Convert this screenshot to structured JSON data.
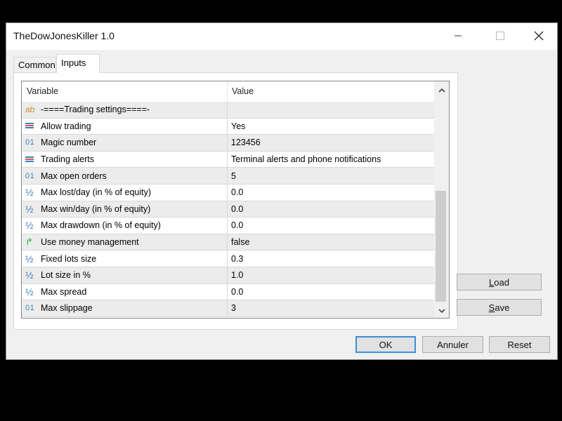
{
  "window": {
    "title": "TheDowJonesKiller 1.0",
    "controls": {
      "minimize": "minimize",
      "maximize": "maximize",
      "close": "close"
    }
  },
  "tabs": [
    {
      "label": "Common",
      "active": false
    },
    {
      "label": "Inputs",
      "active": true
    }
  ],
  "grid": {
    "columns": [
      "Variable",
      "Value"
    ],
    "rows": [
      {
        "icon": "string-icon",
        "variable": "-====Trading settings====-",
        "value": ""
      },
      {
        "icon": "enum-icon",
        "variable": "Allow trading",
        "value": "Yes"
      },
      {
        "icon": "integer-icon",
        "variable": "Magic number",
        "value": "123456"
      },
      {
        "icon": "enum-icon",
        "variable": "Trading alerts",
        "value": "Terminal alerts and phone notifications"
      },
      {
        "icon": "integer-icon",
        "variable": "Max open orders",
        "value": "5"
      },
      {
        "icon": "double-icon",
        "variable": "Max lost/day (in % of equity)",
        "value": "0.0"
      },
      {
        "icon": "double-icon",
        "variable": "Max win/day (in % of equity)",
        "value": "0.0"
      },
      {
        "icon": "double-icon",
        "variable": "Max drawdown (in % of equity)",
        "value": "0.0"
      },
      {
        "icon": "bool-icon",
        "variable": "Use money management",
        "value": "false"
      },
      {
        "icon": "double-icon",
        "variable": "Fixed lots size",
        "value": "0.3"
      },
      {
        "icon": "double-icon",
        "variable": "Lot size in %",
        "value": "1.0"
      },
      {
        "icon": "double-icon",
        "variable": "Max spread",
        "value": "0.0"
      },
      {
        "icon": "integer-icon",
        "variable": "Max slippage",
        "value": "3"
      }
    ],
    "icon_glyphs": {
      "string": "ab",
      "integer": "01",
      "double": "½",
      "bool": "↱"
    },
    "scroll_position": 1.0
  },
  "side_buttons": {
    "load": {
      "accel": "L",
      "rest": "oad"
    },
    "save": {
      "accel": "S",
      "rest": "ave"
    }
  },
  "footer_buttons": {
    "ok": "OK",
    "cancel": "Annuler",
    "reset": "Reset"
  },
  "colors": {
    "enum_icon_blue": "#3a7fc0",
    "enum_icon_red": "#d9534f",
    "ok_focus": "#3c8fd6"
  }
}
